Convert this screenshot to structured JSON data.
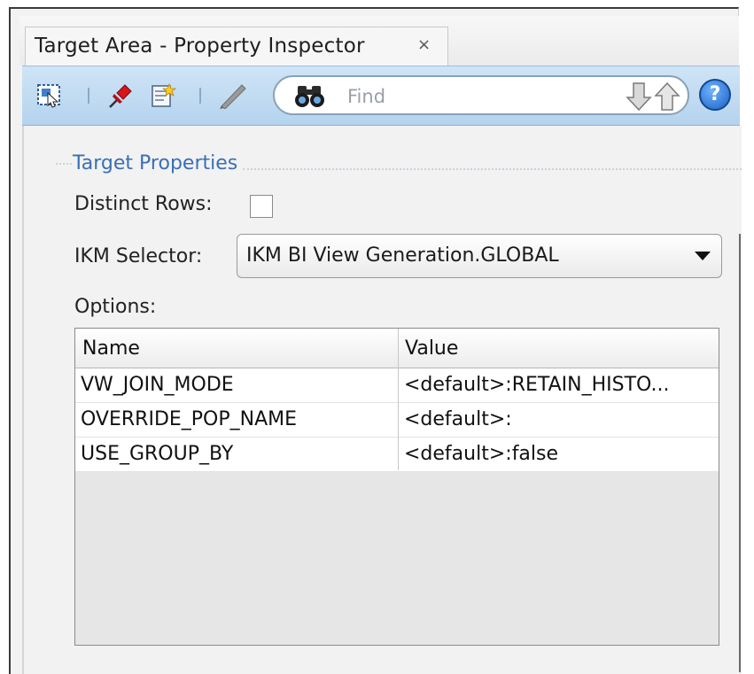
{
  "window": {
    "tab_title": "Target Area - Property Inspector",
    "close_glyph": "×"
  },
  "toolbar": {
    "icons": [
      "select-icon",
      "pin-icon",
      "edit-properties-icon",
      "pencil-icon",
      "binoculars-icon",
      "arrow-down-icon",
      "arrow-up-icon",
      "help-icon"
    ],
    "find_placeholder": "Find",
    "help_glyph": "?"
  },
  "panel": {
    "section_title": "Target Properties",
    "distinct_rows_label": "Distinct Rows:",
    "distinct_rows_checked": false,
    "ikm_selector_label": "IKM Selector:",
    "ikm_selector_value": "IKM BI View Generation.GLOBAL",
    "options_label": "Options:",
    "table": {
      "headers": {
        "name": "Name",
        "value": "Value"
      },
      "rows": [
        {
          "name": "VW_JOIN_MODE",
          "value": "<default>:RETAIN_HISTO..."
        },
        {
          "name": "OVERRIDE_POP_NAME",
          "value": "<default>:"
        },
        {
          "name": "USE_GROUP_BY",
          "value": "<default>:false"
        }
      ]
    }
  },
  "colors": {
    "toolbar_bg": "#c2dcf2",
    "section_title": "#3a6fb5",
    "panel_bg": "#f2f2f2"
  }
}
